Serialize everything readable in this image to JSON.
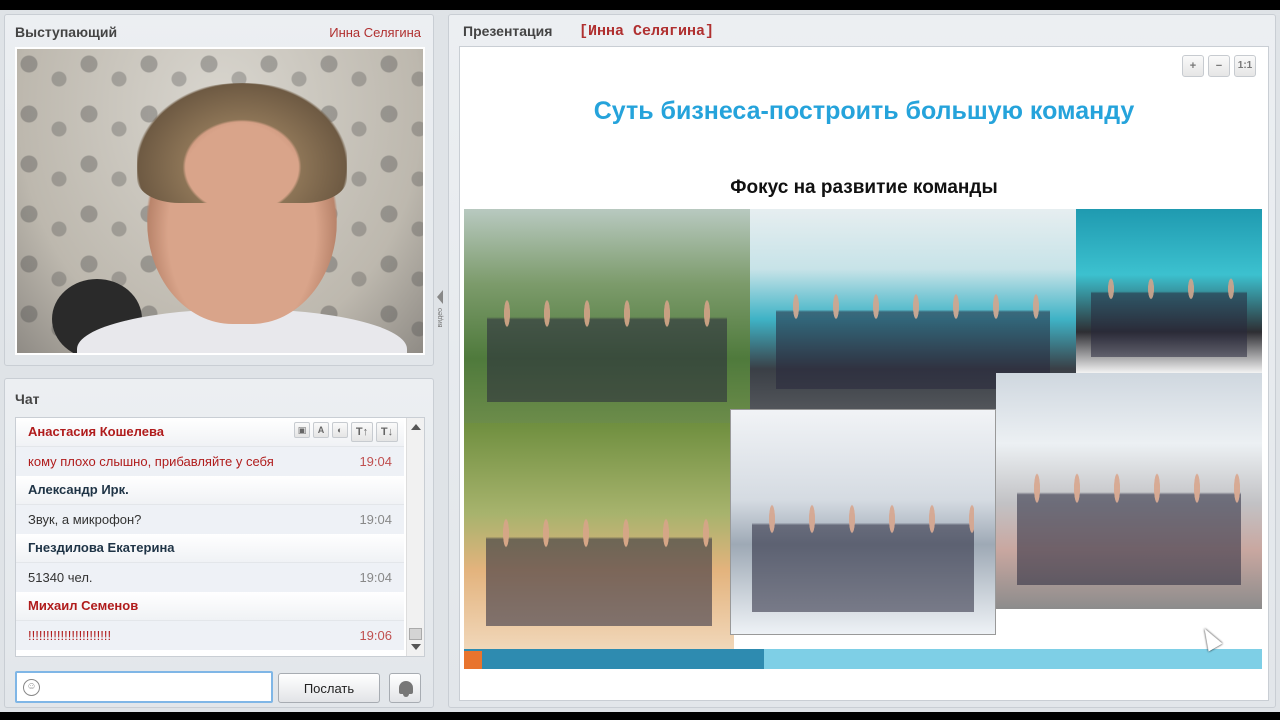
{
  "speaker": {
    "title": "Выступающий",
    "presenter": "Инна Селягина",
    "divider_label": "видео"
  },
  "chat": {
    "title": "Чат",
    "messages": [
      {
        "author": "Анастасия Кошелева",
        "text": "кому плохо слышно, прибавляйте у себя",
        "time": "19:04",
        "color": "#b01c1c"
      },
      {
        "author": "Александр Ирк.",
        "text": "Звук, а микрофон?",
        "time": "19:04",
        "color": "#1f3446"
      },
      {
        "author": "Гнездилова Екатерина",
        "text": "51340 чел.",
        "time": "19:04",
        "color": "#1f3446"
      },
      {
        "author": "Михаил Семенов",
        "text": "!!!!!!!!!!!!!!!!!!!!!!!",
        "time": "19:06",
        "color": "#b01c1c"
      }
    ],
    "tool_icons": [
      "image-icon",
      "font-icon",
      "color-icon",
      "font-increase-icon",
      "font-decrease-icon"
    ],
    "input_value": "",
    "input_placeholder": "",
    "send_label": "Послать"
  },
  "presentation": {
    "title": "Презентация",
    "presenter": "[Инна Селягина]",
    "zoom_in": "+",
    "zoom_out": "−",
    "zoom_reset": "1:1",
    "slide": {
      "heading": "Суть бизнеса-построить большую команду",
      "subheading": "Фокус на развитие команды"
    }
  },
  "colors": {
    "accent_blue": "#25a3db",
    "presenter_red": "#b03030"
  }
}
